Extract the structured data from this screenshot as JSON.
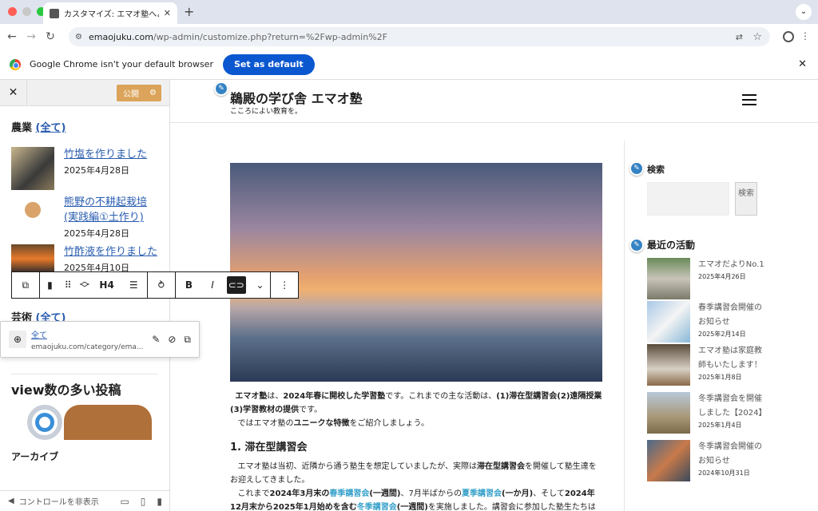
{
  "browser": {
    "tab_title": "カスタマイズ: エマオ塾へようこ",
    "url_domain": "emaojuku.com",
    "url_path": "/wp-admin/customize.php?return=%2Fwp-admin%2F",
    "default_banner_text": "Google Chrome isn't your default browser",
    "set_default_label": "Set as default"
  },
  "customizer": {
    "publish_label": "公開",
    "sections": [
      {
        "title": "農業",
        "all_link": "(全て)"
      },
      {
        "title": "芸術",
        "all_link": "(全て)"
      }
    ],
    "posts": [
      {
        "title": "竹塩を作りました",
        "date": "2025年4月28日"
      },
      {
        "title": "熊野の不耕起栽培(実践編①土作り)",
        "date": "2025年4月28日"
      },
      {
        "title": "竹酢液を作りました",
        "date": "2025年4月10日"
      }
    ],
    "block_toolbar": {
      "heading_level": "H4"
    },
    "link_popover": {
      "text": "全て",
      "url": "emaojuku.com/category/ema..."
    },
    "popular_title": "view数の多い投稿",
    "archive_title": "アーカイブ",
    "hide_controls_label": "コントロールを非表示"
  },
  "site": {
    "title": "鵜殿の学び舎 エマオ塾",
    "tagline": "こころによい教育を。",
    "intro_p1_a": "エマオ塾",
    "intro_p1_b": "は、",
    "intro_p1_c": "2024年春に開校した学習塾",
    "intro_p1_d": "です。これまでの主な活動は、",
    "intro_p1_e": "(1)滞在型講習会(2)遠隔授業(3)学習教材の提供",
    "intro_p1_f": "です。",
    "intro_p2_a": "ではエマオ塾の",
    "intro_p2_b": "ユニークな特徴",
    "intro_p2_c": "をご紹介しましょう。",
    "section1_title": "1. 滞在型講習会",
    "p3_a": "エマオ塾は当初、近隣から通う塾生を想定していましたが、実際は",
    "p3_b": "滞在型講習会",
    "p3_c": "を開催して塾生達をお迎えしてきました。",
    "p4_a": "これまで",
    "p4_b": "2024年3月末の",
    "p4_c": "春季講習会",
    "p4_d": "(一週間)",
    "p4_e": "、7月半ばからの",
    "p4_f": "夏季講習会",
    "p4_g": "(一か月)",
    "p4_h": "、そして",
    "p4_i": "2024年12月末から2025年1月始めを含む",
    "p4_j": "冬季講習会",
    "p4_k": "(一週間)",
    "p4_l": "を実施しました。講習会に参加した塾生たちは皆遠方か"
  },
  "sidebar": {
    "search_title": "検索",
    "search_button": "検索",
    "recent_title": "最近の活動",
    "recent": [
      {
        "title": "エマオだよりNo.1",
        "date": "2025年4月26日"
      },
      {
        "title": "春季講習会開催のお知らせ",
        "date": "2025年2月14日"
      },
      {
        "title": "エマオ塾は家庭教師もいたします！",
        "date": "2025年1月8日"
      },
      {
        "title": "冬季講習会を開催しました【2024】",
        "date": "2025年1月4日"
      },
      {
        "title": "冬季講習会開催のお知らせ",
        "date": "2024年10月31日"
      }
    ]
  }
}
